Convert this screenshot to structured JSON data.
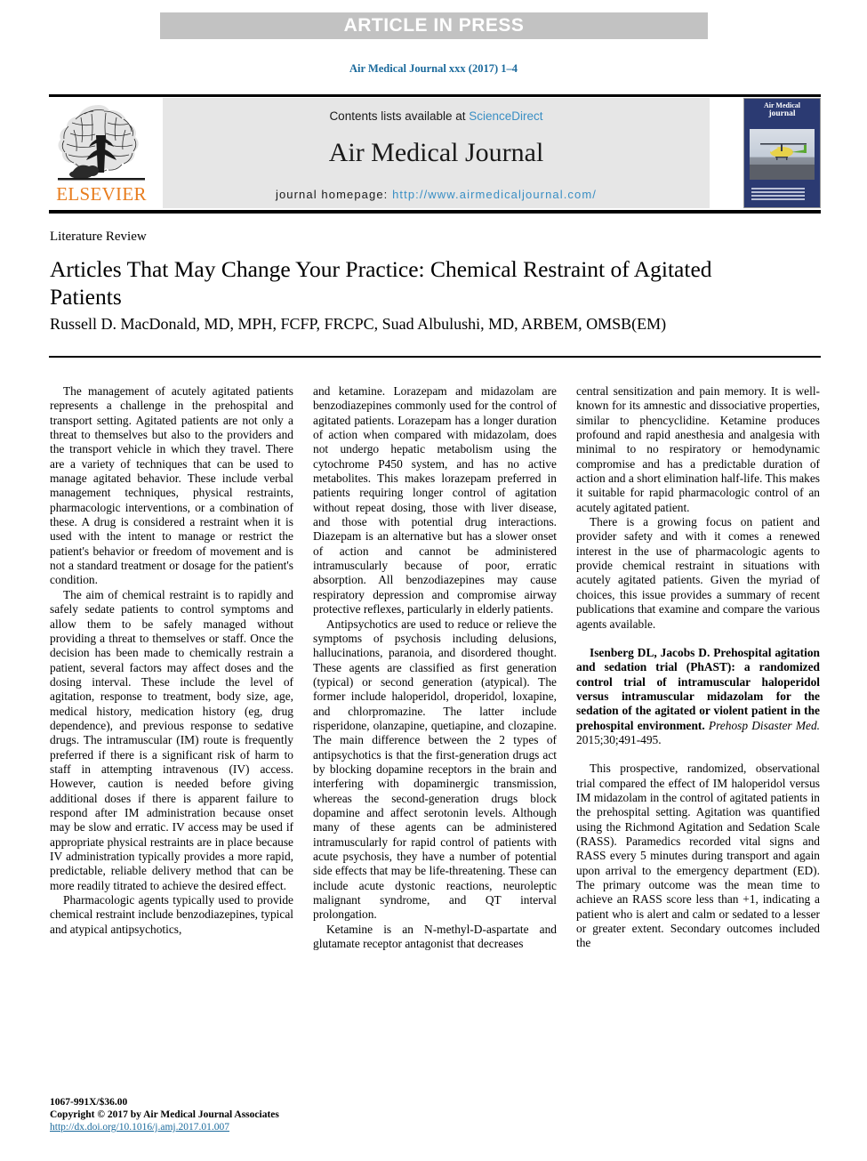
{
  "banner": {
    "text": "ARTICLE IN PRESS"
  },
  "running_head": "Air Medical Journal xxx (2017) 1–4",
  "masthead": {
    "contents_prefix": "Contents lists available at ",
    "contents_link": "ScienceDirect",
    "journal_name": "Air Medical Journal",
    "homepage_prefix": "journal homepage: ",
    "homepage_url": "http://www.airmedicaljournal.com/",
    "publisher_name": "ELSEVIER",
    "cover": {
      "title_line1": "Air Medical",
      "title_line2": "journal"
    }
  },
  "article": {
    "section_label": "Literature Review",
    "title": "Articles That May Change Your Practice: Chemical Restraint of Agitated Patients",
    "authors": "Russell D. MacDonald, MD, MPH, FCFP, FRCPC, Suad Albulushi, MD, ARBEM, OMSB(EM)"
  },
  "body": {
    "column1": [
      "The management of acutely agitated patients represents a challenge in the prehospital and transport setting. Agitated patients are not only a threat to themselves but also to the providers and the transport vehicle in which they travel. There are a variety of techniques that can be used to manage agitated behavior. These include verbal management techniques, physical restraints, pharmacologic interventions, or a combination of these. A drug is considered a restraint when it is used with the intent to manage or restrict the patient's behavior or freedom of movement and is not a standard treatment or dosage for the patient's condition.",
      "The aim of chemical restraint is to rapidly and safely sedate patients to control symptoms and allow them to be safely managed without providing a threat to themselves or staff. Once the decision has been made to chemically restrain a patient, several factors may affect doses and the dosing interval. These include the level of agitation, response to treatment, body size, age, medical history, medication history (eg, drug dependence), and previous response to sedative drugs. The intramuscular (IM) route is frequently preferred if there is a significant risk of harm to staff in attempting intravenous (IV) access. However, caution is needed before giving additional doses if there is apparent failure to respond after IM administration because onset may be slow and erratic. IV access may be used if appropriate physical restraints are in place because IV administration typically provides a more rapid, predictable, reliable delivery method that can be more readily titrated to achieve the desired effect.",
      "Pharmacologic agents typically used to provide chemical restraint include benzodiazepines, typical and atypical antipsychotics,"
    ],
    "column2": [
      "and ketamine. Lorazepam and midazolam are benzodiazepines commonly used for the control of agitated patients. Lorazepam has a longer duration of action when compared with midazolam, does not undergo hepatic metabolism using the cytochrome P450 system, and has no active metabolites. This makes lorazepam preferred in patients requiring longer control of agitation without repeat dosing, those with liver disease, and those with potential drug interactions. Diazepam is an alternative but has a slower onset of action and cannot be administered intramuscularly because of poor, erratic absorption. All benzodiazepines may cause respiratory depression and compromise airway protective reflexes, particularly in elderly patients.",
      "Antipsychotics are used to reduce or relieve the symptoms of psychosis including delusions, hallucinations, paranoia, and disordered thought. These agents are classified as first generation (typical) or second generation (atypical). The former include haloperidol, droperidol, loxapine, and chlorpromazine. The latter include risperidone, olanzapine, quetiapine, and clozapine. The main difference between the 2 types of antipsychotics is that the first-generation drugs act by blocking dopamine receptors in the brain and interfering with dopaminergic transmission, whereas the second-generation drugs block dopamine and affect serotonin levels. Although many of these agents can be administered intramuscularly for rapid control of patients with acute psychosis, they have a number of potential side effects that may be life-threatening. These can include acute dystonic reactions, neuroleptic malignant syndrome, and QT interval prolongation.",
      "Ketamine is an N-methyl-D-aspartate and glutamate receptor antagonist that decreases"
    ],
    "column3": {
      "paragraphs": [
        "central sensitization and pain memory. It is well-known for its amnestic and dissociative properties, similar to phencyclidine. Ketamine produces profound and rapid anesthesia and analgesia with minimal to no respiratory or hemodynamic compromise and has a predictable duration of action and a short elimination half-life. This makes it suitable for rapid pharmacologic control of an acutely agitated patient.",
        "There is a growing focus on patient and provider safety and with it comes a renewed interest in the use of pharmacologic agents to provide chemical restraint in situations with acutely agitated patients. Given the myriad of choices, this issue provides a summary of recent publications that examine and compare the various agents available."
      ],
      "citation": {
        "bold_text": "Isenberg DL, Jacobs D. Prehospital agitation and sedation trial (PhAST): a randomized control trial of intramuscular haloperidol versus intramuscular midazolam for the sedation of the agitated or violent patient in the prehospital environment.",
        "journal_italic": " Prehosp Disaster Med.",
        "citation_detail": " 2015;30;491-495."
      },
      "final_paragraph": "This prospective, randomized, observational trial compared the effect of IM haloperidol versus IM midazolam in the control of agitated patients in the prehospital setting. Agitation was quantified using the Richmond Agitation and Sedation Scale (RASS). Paramedics recorded vital signs and RASS every 5 minutes during transport and again upon arrival to the emergency department (ED). The primary outcome was the mean time to achieve an RASS score less than +1, indicating a patient who is alert and calm or sedated to a lesser or greater extent. Secondary outcomes included the"
    }
  },
  "footer": {
    "issn": "1067-991X/$36.00",
    "copyright": "Copyright © 2017 by Air Medical Journal Associates",
    "doi": "http://dx.doi.org/10.1016/j.amj.2017.01.007"
  },
  "colors": {
    "banner_bg": "#c2c2c2",
    "link_blue": "#1b6a9c",
    "sciencedirect_blue": "#3a8fc4",
    "elsevier_orange": "#e87d1e",
    "masthead_bg": "#e6e6e6",
    "cover_navy": "#2b3a72"
  }
}
